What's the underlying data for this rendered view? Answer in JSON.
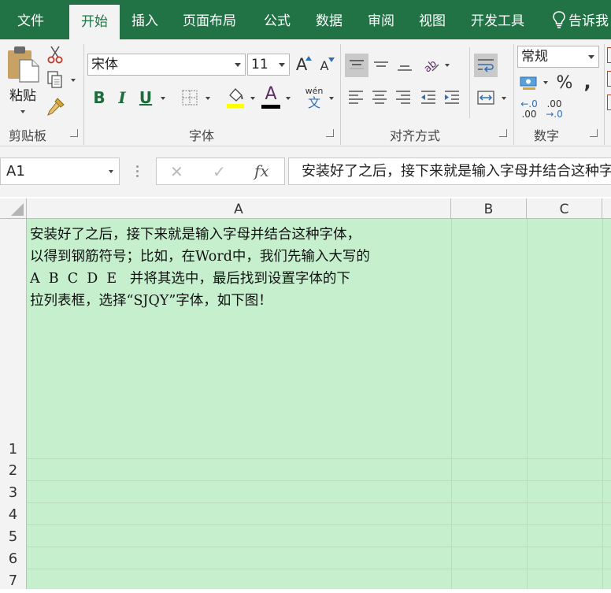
{
  "tabs": [
    "文件",
    "开始",
    "插入",
    "页面布局",
    "公式",
    "数据",
    "审阅",
    "视图",
    "开发工具",
    "告诉我"
  ],
  "active_tab": "开始",
  "ribbon": {
    "clipboard": {
      "paste_label": "粘贴",
      "group_label": "剪贴板"
    },
    "font": {
      "font_name": "宋体",
      "font_size": "11",
      "grow_label": "A",
      "shrink_label": "A",
      "bold": "B",
      "italic": "I",
      "underline": "U",
      "font_color_label": "A",
      "phonetic_top": "wén",
      "phonetic_bottom": "文",
      "group_label": "字体",
      "highlight_color": "#ffff00",
      "font_color": "#000000"
    },
    "alignment": {
      "group_label": "对齐方式"
    },
    "number": {
      "format": "常规",
      "percent": "%",
      "comma": ",",
      "inc_top": "←.0",
      "inc_bottom": ".00",
      "dec_top": ".00",
      "dec_bottom": "→.0",
      "group_label": "数字"
    }
  },
  "formula_bar": {
    "name_box": "A1",
    "cancel_icon": "✕",
    "enter_icon": "✓",
    "fx_label": "fx",
    "formula": "安装好了之后，接下来就是输入字母并结合这种字体，以得到钢筋符号；比如，在Word中，我们先输入大写的 A B C D E 并将其选中，最后找到设置字体的下拉列表框，选择“SJQY”字体，如下图！"
  },
  "columns": [
    "A",
    "B",
    "C"
  ],
  "rows": [
    "1",
    "2",
    "3",
    "4",
    "5",
    "6",
    "7"
  ],
  "cell_a1_lines": [
    "安装好了之后，接下来就是输入字母并结合这种字体，",
    "以得到钢筋符号；比如，在Word中，我们先输入大写的",
    "A  B  C  D  E   并将其选中，最后找到设置字体的下",
    "拉列表框，选择“SJQY”字体，如下图！"
  ],
  "colors": {
    "brand": "#217346",
    "cell_fill": "#c6efce"
  }
}
